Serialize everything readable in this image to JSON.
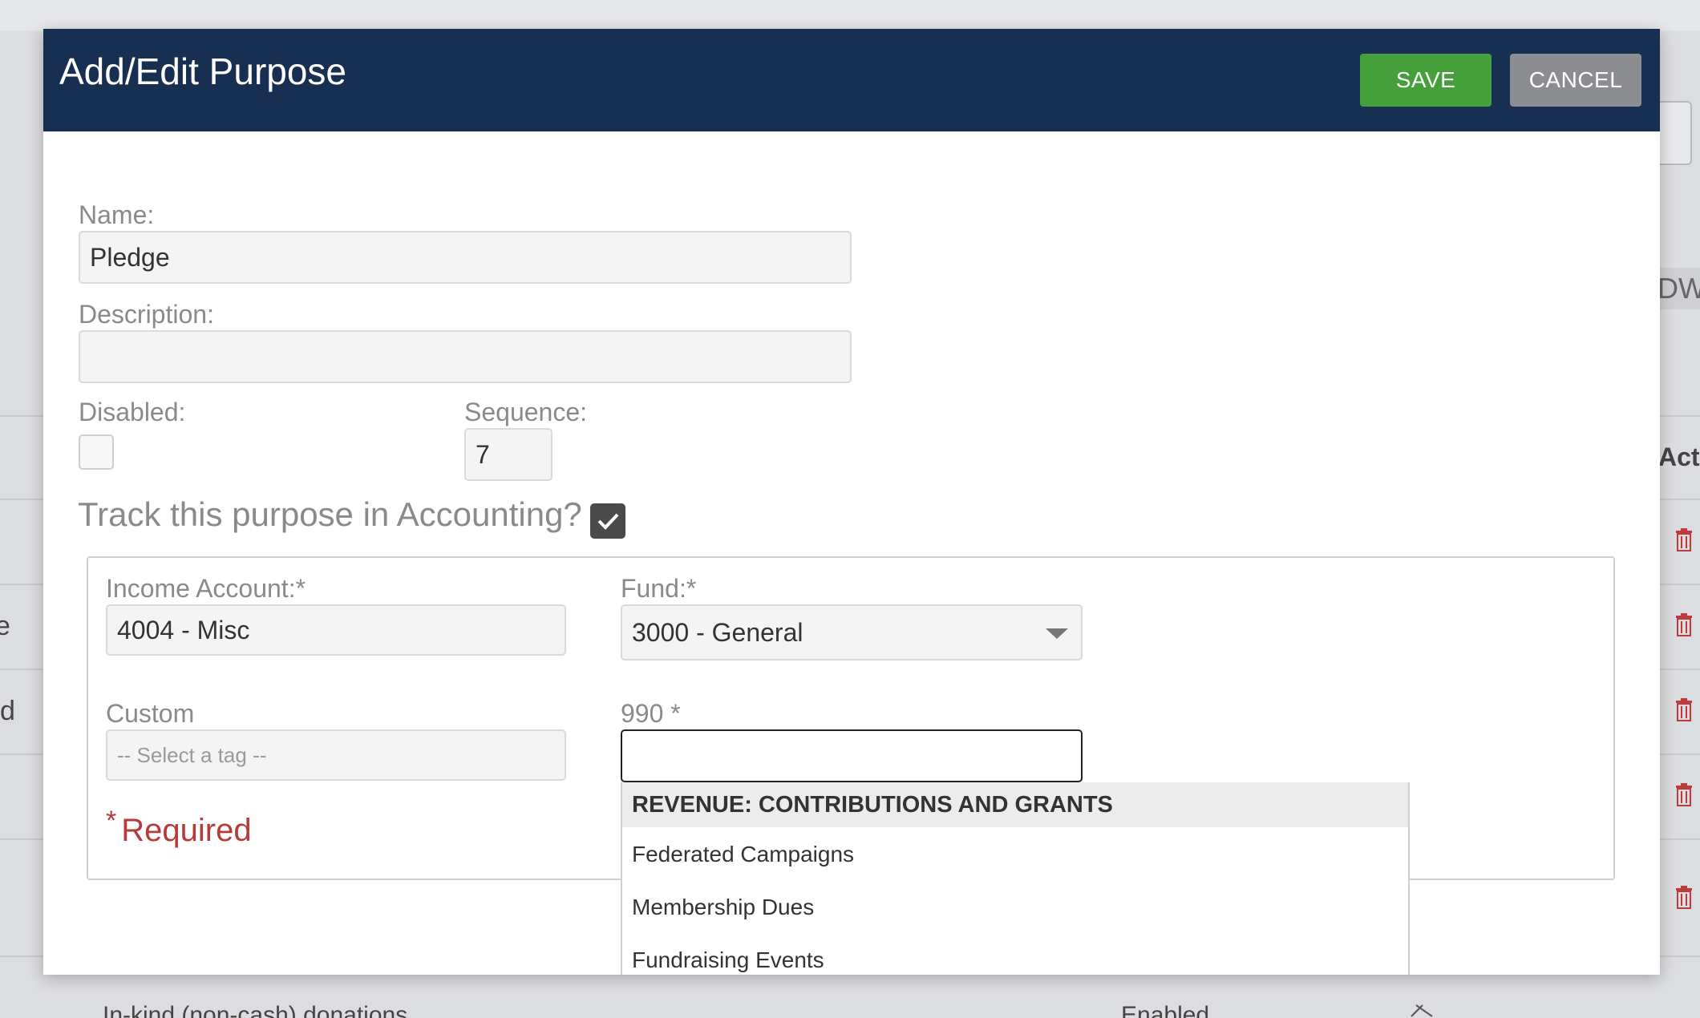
{
  "modal": {
    "title": "Add/Edit Purpose",
    "save_label": "SAVE",
    "cancel_label": "CANCEL"
  },
  "form": {
    "name_label": "Name:",
    "name_value": "Pledge",
    "description_label": "Description:",
    "description_value": "",
    "disabled_label": "Disabled:",
    "disabled_checked": false,
    "sequence_label": "Sequence:",
    "sequence_value": "7",
    "track_label": "Track this purpose in Accounting?",
    "track_checked": true
  },
  "accounting": {
    "income_label": "Income Account:*",
    "income_value": "4004 - Misc",
    "fund_label": "Fund:*",
    "fund_value": "3000 - General",
    "custom_label": "Custom",
    "custom_placeholder": "-- Select a tag --",
    "form990_label": "990 *",
    "form990_value": "",
    "required_star": "*",
    "required_label": "Required"
  },
  "dropdown": {
    "group_header": "REVENUE: CONTRIBUTIONS AND GRANTS",
    "items": [
      "Federated Campaigns",
      "Membership Dues",
      "Fundraising Events"
    ]
  },
  "background": {
    "edge_chars": [
      "e",
      "d"
    ],
    "right_column_header": "Acti",
    "right_label_fragment": "DW",
    "bottom_row_name": "In-kind (non-cash) donations",
    "bottom_row_status": "Enabled"
  },
  "colors": {
    "header_bg": "#172f50",
    "save_bg": "#45a03b",
    "cancel_bg": "#8c8d91",
    "required": "#b73a3a",
    "trash": "#c0393b"
  }
}
